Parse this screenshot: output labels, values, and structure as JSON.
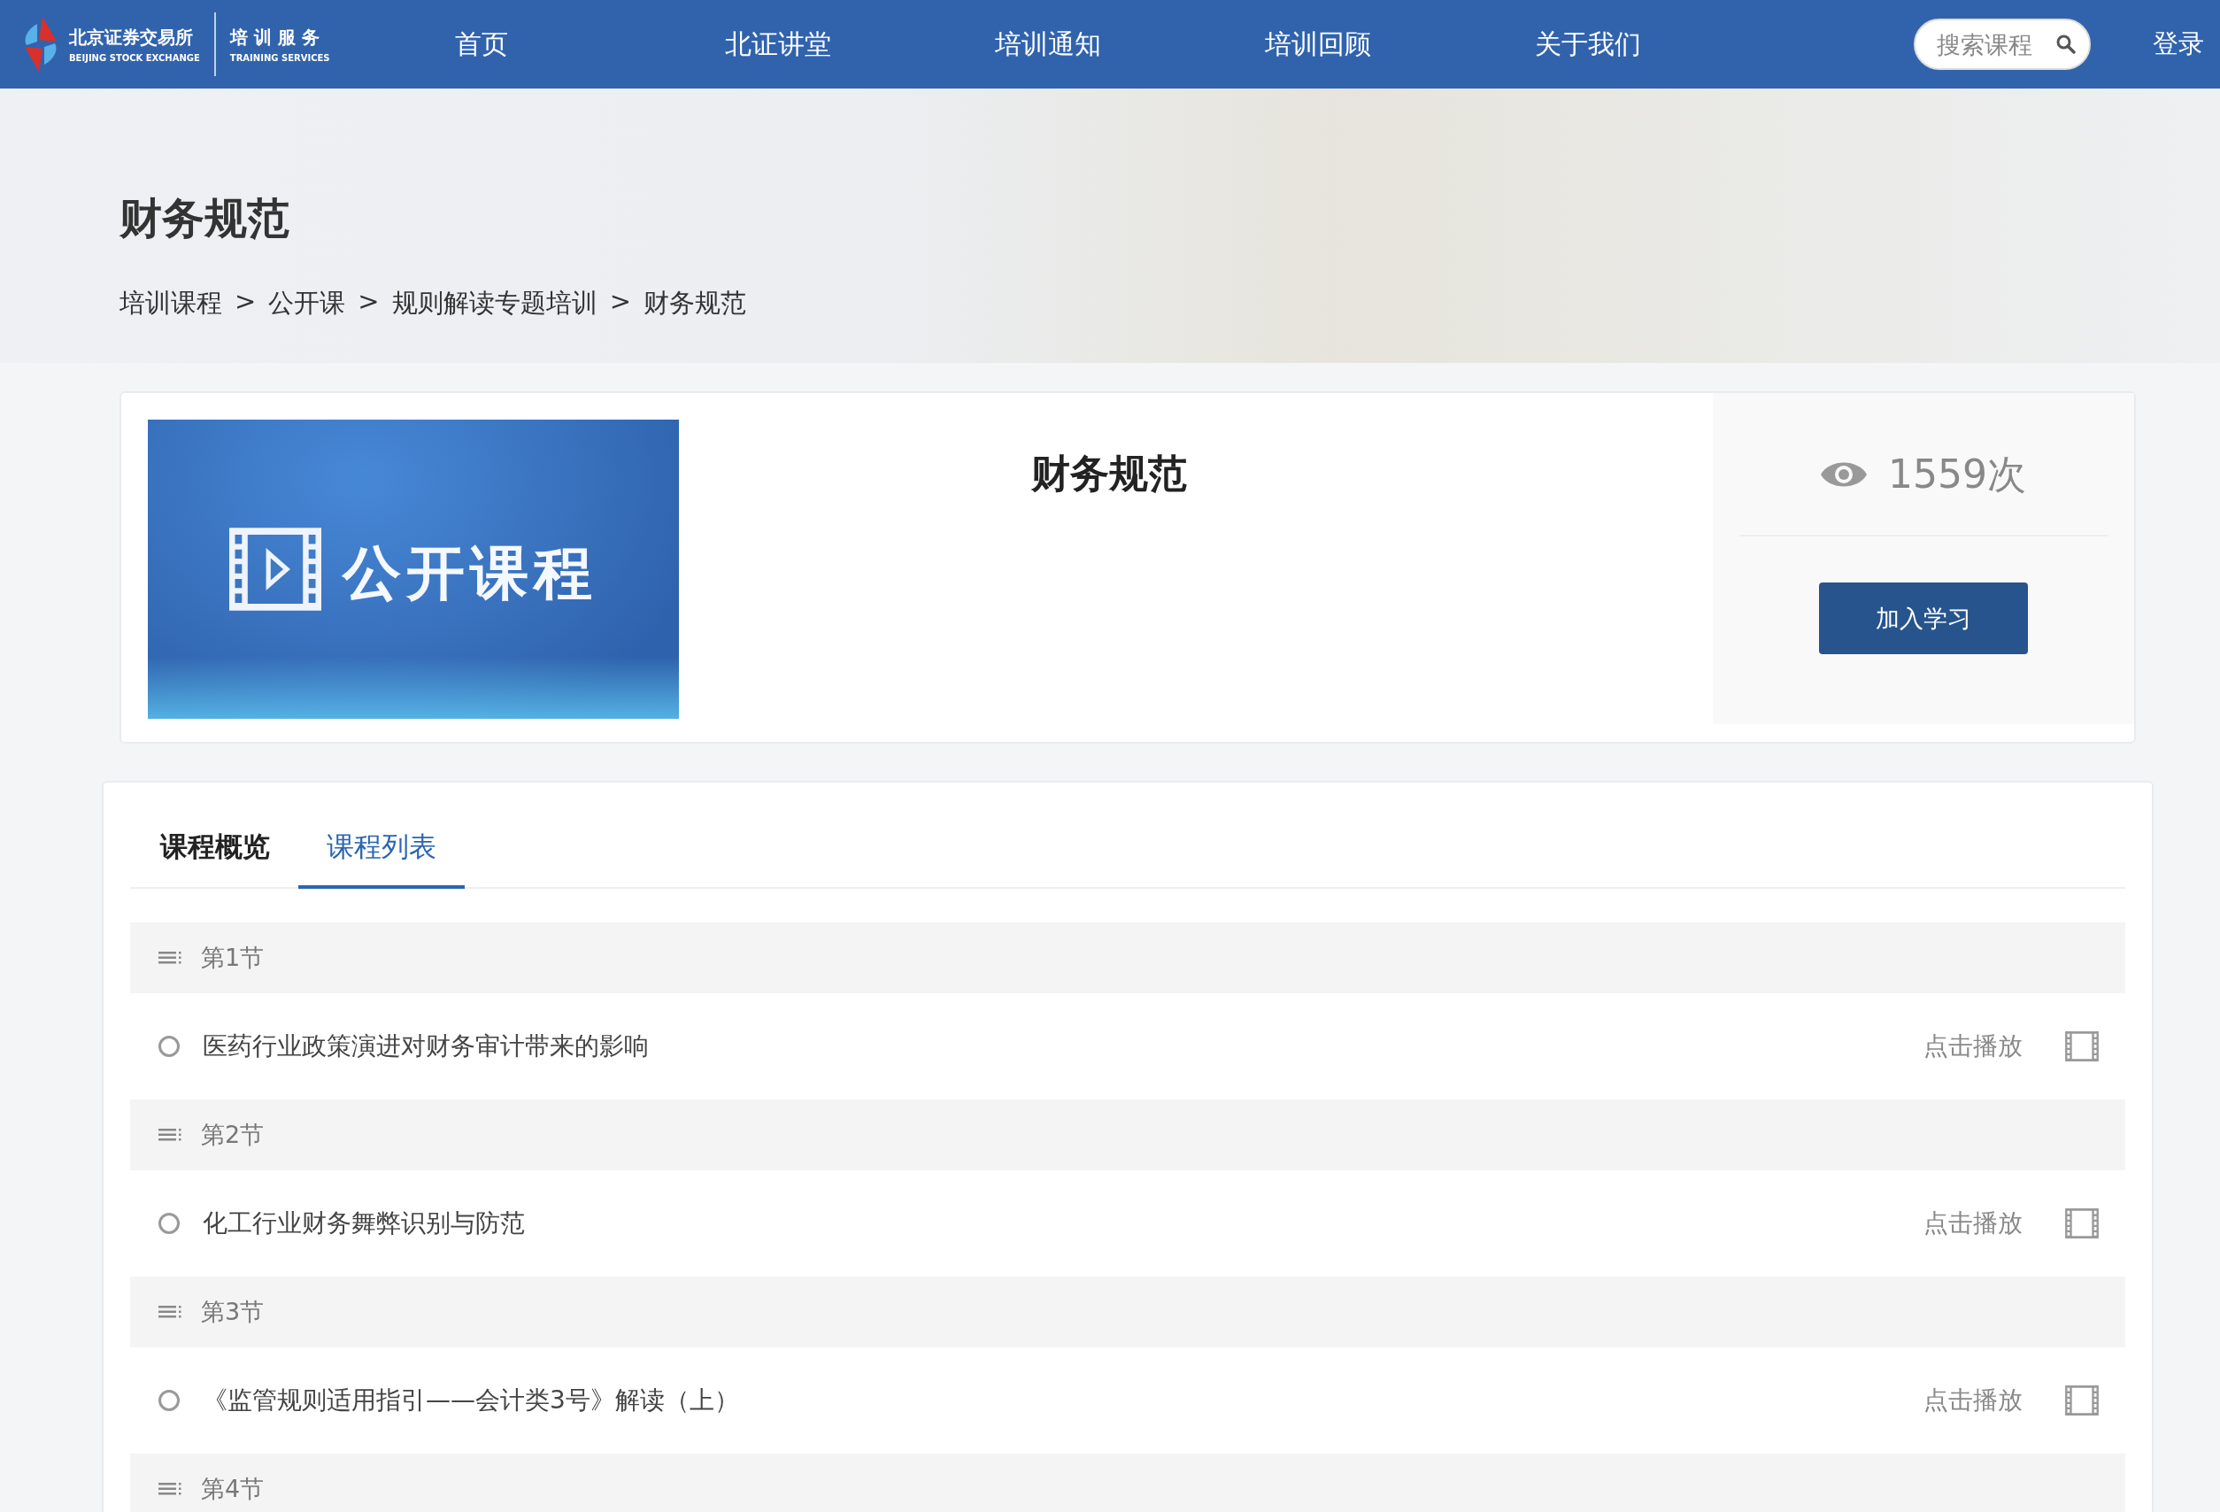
{
  "header": {
    "logo": {
      "name_cn": "北京证券交易所",
      "name_en": "BEIJING STOCK EXCHANGE",
      "service_cn": "培 训 服 务",
      "service_en": "TRAINING SERVICES"
    },
    "nav": [
      "首页",
      "北证讲堂",
      "培训通知",
      "培训回顾",
      "关于我们"
    ],
    "search": {
      "placeholder": "搜索课程"
    },
    "login": "登录"
  },
  "banner": {
    "title": "财务规范",
    "separator": ">",
    "breadcrumb": [
      "培训课程",
      "公开课",
      "规则解读专题培训",
      "财务规范"
    ]
  },
  "course": {
    "thumbnail_caption": "公开课程",
    "title": "财务规范",
    "views": "1559次",
    "join_button": "加入学习"
  },
  "tabs": [
    {
      "label": "课程概览",
      "selected": false
    },
    {
      "label": "课程列表",
      "selected": true
    }
  ],
  "sections": [
    {
      "title": "第1节",
      "lessons": [
        {
          "title": "医药行业政策演进对财务审计带来的影响",
          "action": "点击播放"
        }
      ]
    },
    {
      "title": "第2节",
      "lessons": [
        {
          "title": "化工行业财务舞弊识别与防范",
          "action": "点击播放"
        }
      ]
    },
    {
      "title": "第3节",
      "lessons": [
        {
          "title": "《监管规则适用指引——会计类3号》解读（上）",
          "action": "点击播放"
        }
      ]
    },
    {
      "title": "第4节"
    }
  ]
}
